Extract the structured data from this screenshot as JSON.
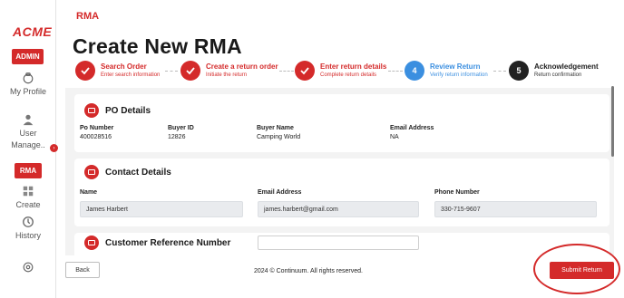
{
  "sidebar": {
    "logo": "ACME",
    "role_badge": "ADMIN",
    "items": [
      {
        "label": "My Profile",
        "icon": "profile-icon"
      },
      {
        "label": "User Manage..",
        "icon": "user-manage-icon"
      },
      {
        "label": "RMA",
        "icon": "rma-badge"
      },
      {
        "label": "Create",
        "icon": "create-grid-icon"
      },
      {
        "label": "History",
        "icon": "history-icon"
      },
      {
        "label": "",
        "icon": "settings-icon"
      }
    ]
  },
  "header": {
    "brand": "RMA",
    "title": "Create New RMA"
  },
  "stepper": [
    {
      "title": "Search Order",
      "subtitle": "Enter search information",
      "state": "done",
      "number": ""
    },
    {
      "title": "Create a return order",
      "subtitle": "Initiate the return",
      "state": "done",
      "number": ""
    },
    {
      "title": "Enter return details",
      "subtitle": "Complete return details",
      "state": "done",
      "number": ""
    },
    {
      "title": "Review Return",
      "subtitle": "Verify return information",
      "state": "active",
      "number": "4"
    },
    {
      "title": "Acknowledgement",
      "subtitle": "Return confirmation",
      "state": "todo",
      "number": "5"
    }
  ],
  "po_details": {
    "title": "PO Details",
    "fields": [
      {
        "label": "Po Number",
        "value": "400028516"
      },
      {
        "label": "Buyer ID",
        "value": "12826"
      },
      {
        "label": "Buyer Name",
        "value": "Camping World"
      },
      {
        "label": "Email Address",
        "value": "NA"
      }
    ]
  },
  "contact_details": {
    "title": "Contact Details",
    "fields": [
      {
        "label": "Name",
        "value": "James Harbert"
      },
      {
        "label": "Email Address",
        "value": "james.harbert@gmail.com"
      },
      {
        "label": "Phone Number",
        "value": "330-715-9607"
      }
    ]
  },
  "customer_reference": {
    "title": "Customer Reference Number",
    "value": ""
  },
  "footer": {
    "back_label": "Back",
    "copyright": "2024 © Continuum. All rights reserved.",
    "submit_label": "Submit Return"
  },
  "colors": {
    "accent": "#d42a2a",
    "active_step": "#3b8fe0",
    "content_bg": "#f3f3f3"
  }
}
